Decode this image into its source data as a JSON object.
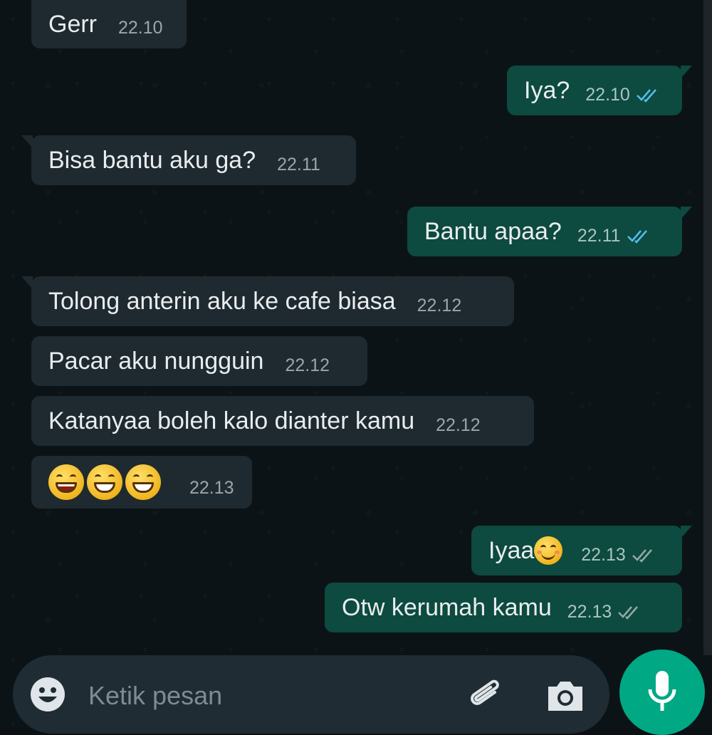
{
  "messages": [
    {
      "direction": "in",
      "text": "Gerr",
      "time": "22.10"
    },
    {
      "direction": "out",
      "text": "Iya?",
      "time": "22.10"
    },
    {
      "direction": "in",
      "text": "Bisa bantu aku ga?",
      "time": "22.11"
    },
    {
      "direction": "out",
      "text": "Bantu apaa?",
      "time": "22.11"
    },
    {
      "direction": "in",
      "text": "Tolong anterin aku ke cafe biasa",
      "time": "22.12"
    },
    {
      "direction": "in",
      "text": "Pacar aku nungguin",
      "time": "22.12"
    },
    {
      "direction": "in",
      "text": "Katanyaa boleh kalo dianter kamu",
      "time": "22.12"
    },
    {
      "direction": "in",
      "text": "😄😁😁",
      "time": "22.13"
    },
    {
      "direction": "out",
      "text": "Iyaa😊",
      "time": "22.13"
    },
    {
      "direction": "out",
      "text": "Otw kerumah kamu",
      "time": "22.13"
    }
  ],
  "composer": {
    "placeholder": "Ketik pesan",
    "emoji_icon": "smiley-icon",
    "attach_icon": "paperclip-icon",
    "camera_icon": "camera-icon",
    "mic_icon": "microphone-icon"
  },
  "colors": {
    "background": "#0c1317",
    "incoming_bubble": "#1e2a30",
    "outgoing_bubble": "#0d4a3f",
    "accent": "#00a884",
    "read_tick": "#53bdeb"
  }
}
